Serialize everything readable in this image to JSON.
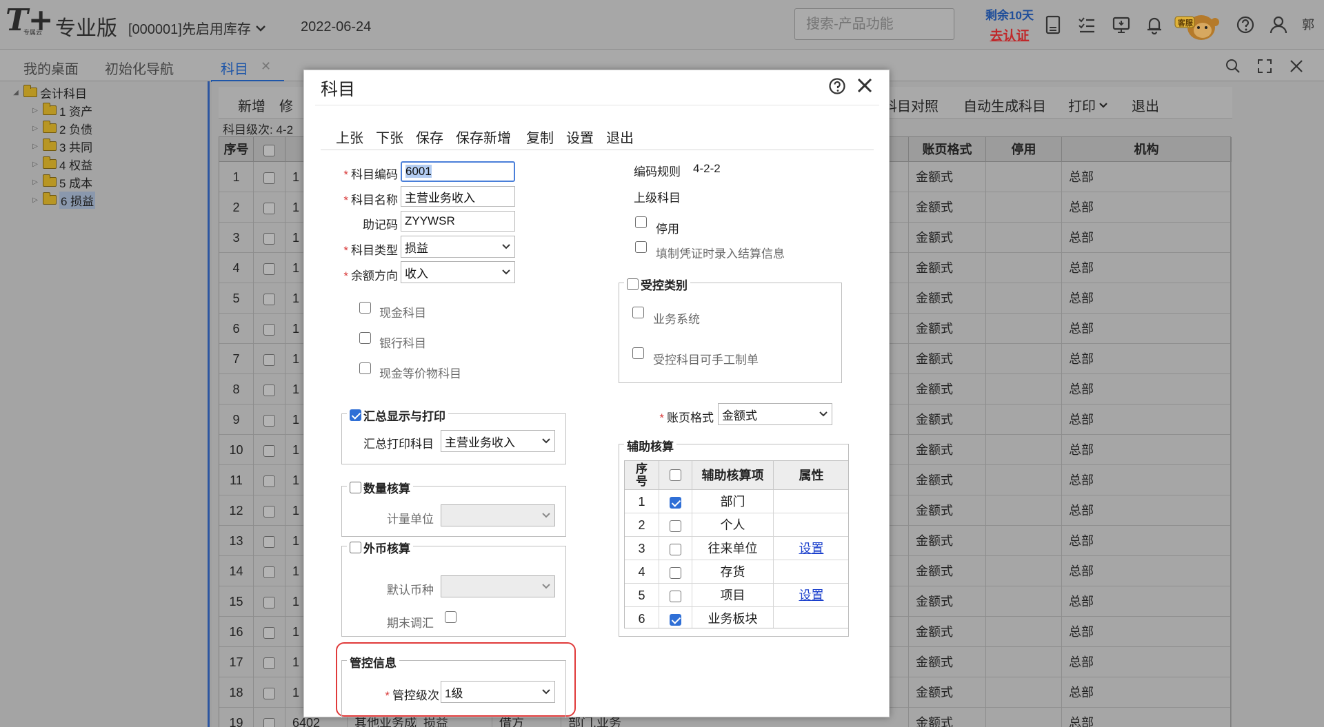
{
  "header": {
    "logo_text": "T+",
    "logo_sub": "专属云",
    "edition": "专业版",
    "account": "[000001]先启用库存",
    "date": "2022-06-24",
    "search_placeholder": "搜索-产品功能",
    "trial_days": "剩余10天",
    "trial_cert": "去认证",
    "mascot_label": "客服",
    "user": "郭"
  },
  "tabs": [
    {
      "label": "我的桌面"
    },
    {
      "label": "初始化导航"
    },
    {
      "label": "科目"
    }
  ],
  "tree": {
    "root": "会计科目",
    "items": [
      "1 资产",
      "2 负债",
      "3 共同",
      "4 权益",
      "5 成本",
      "6 损益"
    ]
  },
  "main": {
    "toolbar": [
      "新增",
      "修",
      "科目对照",
      "自动生成科目",
      "打印",
      "退出"
    ],
    "level_label": "科目级次:",
    "level_value": "4-2",
    "columns": [
      "序号",
      "",
      "账页格式",
      "停用",
      "机构"
    ],
    "rows": [
      {
        "no": "1",
        "code": "1",
        "format": "金额式",
        "org": "总部"
      },
      {
        "no": "2",
        "code": "1",
        "format": "金额式",
        "org": "总部"
      },
      {
        "no": "3",
        "code": "1",
        "format": "金额式",
        "org": "总部"
      },
      {
        "no": "4",
        "code": "1",
        "format": "金额式",
        "org": "总部"
      },
      {
        "no": "5",
        "code": "1",
        "format": "金额式",
        "org": "总部"
      },
      {
        "no": "6",
        "code": "1",
        "format": "金额式",
        "org": "总部"
      },
      {
        "no": "7",
        "code": "1",
        "format": "金额式",
        "org": "总部"
      },
      {
        "no": "8",
        "code": "1",
        "format": "金额式",
        "org": "总部"
      },
      {
        "no": "9",
        "code": "1",
        "format": "金额式",
        "org": "总部"
      },
      {
        "no": "10",
        "code": "1",
        "format": "金额式",
        "org": "总部"
      },
      {
        "no": "11",
        "code": "1",
        "format": "金额式",
        "org": "总部"
      },
      {
        "no": "12",
        "code": "1",
        "format": "金额式",
        "org": "总部"
      },
      {
        "no": "13",
        "code": "1",
        "format": "金额式",
        "org": "总部"
      },
      {
        "no": "14",
        "code": "1",
        "format": "金额式",
        "org": "总部"
      },
      {
        "no": "15",
        "code": "1",
        "format": "金额式",
        "org": "总部"
      },
      {
        "no": "16",
        "code": "1",
        "format": "金额式",
        "org": "总部"
      },
      {
        "no": "17",
        "code": "1",
        "format": "金额式",
        "org": "总部"
      },
      {
        "no": "18",
        "code": "1",
        "format": "金额式",
        "org": "总部"
      }
    ],
    "last_row": {
      "no": "19",
      "code": "6402",
      "name": "其他业务成本",
      "type": "损益",
      "dir": "借方",
      "aux": "部门,业务",
      "format": "金额式",
      "org": "总部"
    }
  },
  "modal": {
    "title": "科目",
    "toolbar": [
      "上张",
      "下张",
      "保存",
      "保存新增",
      "复制",
      "设置",
      "退出"
    ],
    "fields": {
      "code_label": "科目编码",
      "code_value": "6001",
      "name_label": "科目名称",
      "name_value": "主营业务收入",
      "mnemonic_label": "助记码",
      "mnemonic_value": "ZYYWSR",
      "type_label": "科目类型",
      "type_value": "损益",
      "balance_label": "余额方向",
      "balance_value": "收入"
    },
    "checks_left": [
      "现金科目",
      "银行科目",
      "现金等价物科目"
    ],
    "summary": {
      "title": "汇总显示与打印",
      "label": "汇总打印科目",
      "value": "主营业务收入"
    },
    "quantity": {
      "title": "数量核算",
      "label": "计量单位",
      "value": ""
    },
    "foreign": {
      "title": "外币核算",
      "label": "默认币种",
      "value": "",
      "adjust_label": "期末调汇"
    },
    "control": {
      "title": "管控信息",
      "label": "管控级次",
      "value": "1级"
    },
    "right": {
      "rule_label": "编码规则",
      "rule_value": "4-2-2",
      "parent_label": "上级科目",
      "disable_label": "停用",
      "settle_label": "填制凭证时录入结算信息",
      "controlled_title": "受控类别",
      "controlled_items": [
        "业务系统",
        "受控科目可手工制单"
      ],
      "ledger_label": "账页格式",
      "ledger_value": "金额式"
    },
    "aux": {
      "title": "辅助核算",
      "columns": [
        "序号",
        "",
        "辅助核算项",
        "属性"
      ],
      "rows": [
        {
          "no": "1",
          "checked": true,
          "item": "部门",
          "attr": ""
        },
        {
          "no": "2",
          "checked": false,
          "item": "个人",
          "attr": ""
        },
        {
          "no": "3",
          "checked": false,
          "item": "往来单位",
          "attr": "设置"
        },
        {
          "no": "4",
          "checked": false,
          "item": "存货",
          "attr": ""
        },
        {
          "no": "5",
          "checked": false,
          "item": "项目",
          "attr": "设置"
        },
        {
          "no": "6",
          "checked": true,
          "item": "业务板块",
          "attr": ""
        }
      ]
    }
  },
  "colors": {
    "accent": "#1f56a8",
    "highlight_border": "#e03a3a",
    "link": "#1a3fcc",
    "trial_red": "#c0282a"
  }
}
